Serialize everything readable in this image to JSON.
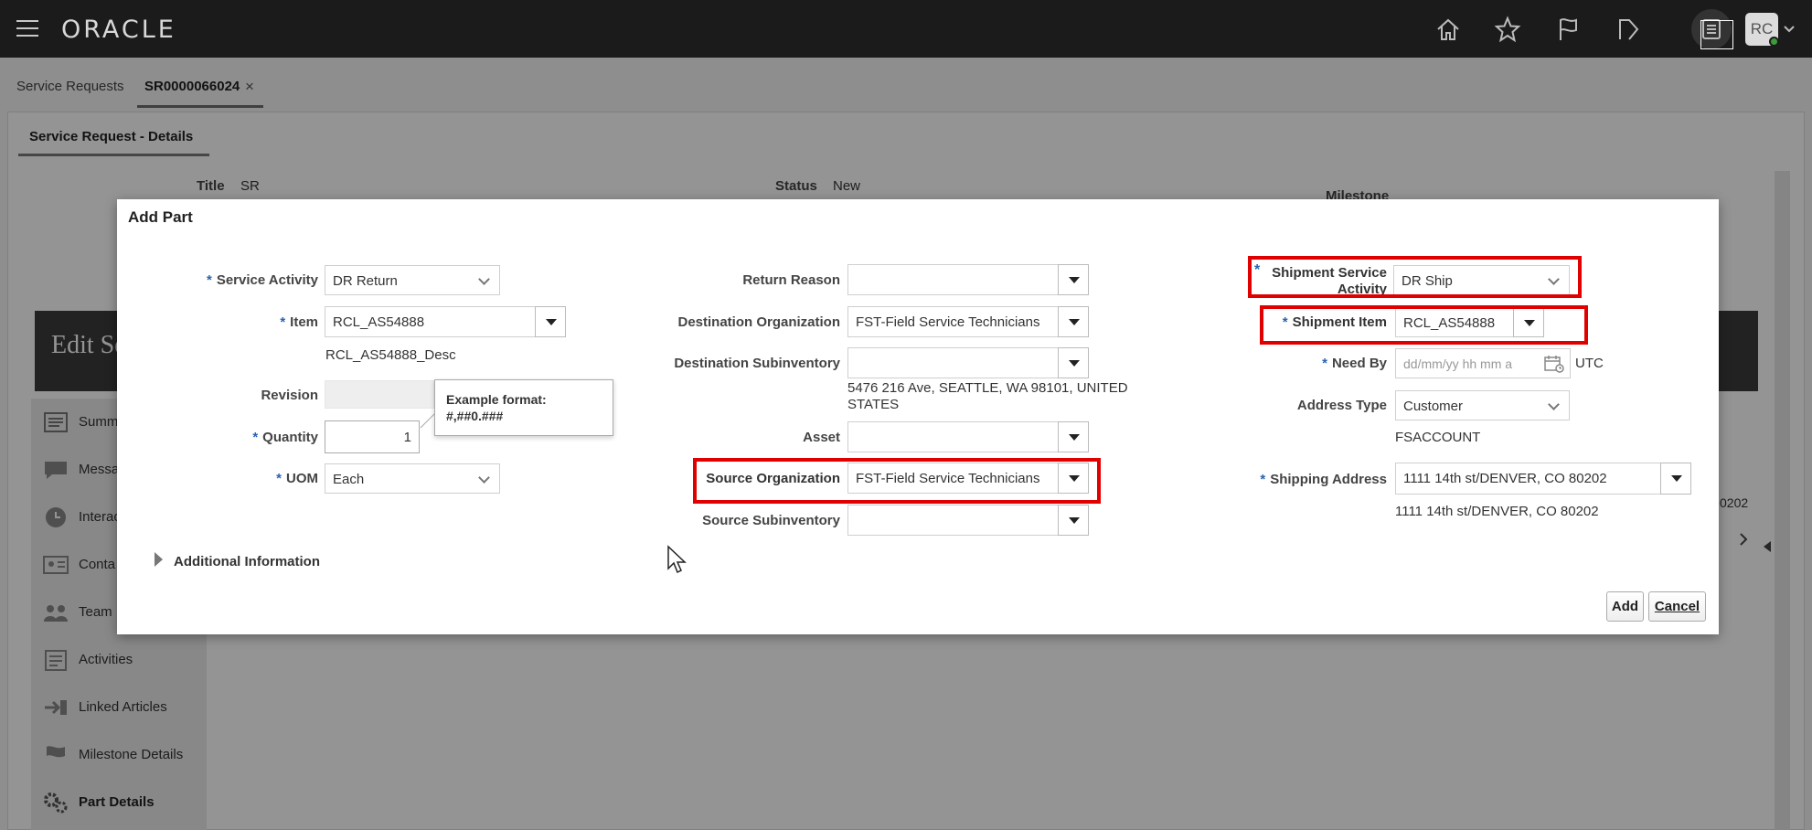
{
  "topbar": {
    "logo": "ORACLE",
    "avatar_initials": "RC"
  },
  "tabs": [
    {
      "label": "Service Requests"
    },
    {
      "label": "SR0000066024"
    }
  ],
  "subtab": "Service Request - Details",
  "background": {
    "title_label": "Title",
    "title_value": "SR",
    "status_label": "Status",
    "status_value": "New",
    "milestone_label": "Milestone",
    "edit_banner": "Edit Se",
    "partial_right_text": "0202",
    "sidebar": [
      {
        "label": "Summ",
        "icon": "summary-icon"
      },
      {
        "label": "Messa",
        "icon": "message-icon"
      },
      {
        "label": "Interac",
        "icon": "interaction-icon"
      },
      {
        "label": "Conta",
        "icon": "contact-icon"
      },
      {
        "label": "Team",
        "icon": "team-icon"
      },
      {
        "label": "Activities",
        "icon": "activities-icon"
      },
      {
        "label": "Linked Articles",
        "icon": "linked-articles-icon"
      },
      {
        "label": "Milestone Details",
        "icon": "milestone-icon"
      },
      {
        "label": "Part Details",
        "icon": "part-details-icon"
      }
    ]
  },
  "dialog": {
    "title": "Add Part",
    "col1": {
      "service_activity_label": "Service Activity",
      "service_activity_value": "DR Return",
      "item_label": "Item",
      "item_value": "RCL_AS54888",
      "item_desc": "RCL_AS54888_Desc",
      "revision_label": "Revision",
      "quantity_label": "Quantity",
      "quantity_value": "1",
      "uom_label": "UOM",
      "uom_value": "Each"
    },
    "tooltip": {
      "line1": "Example format:",
      "line2": "#,##0.###"
    },
    "col2": {
      "return_reason_label": "Return Reason",
      "return_reason_value": "",
      "dest_org_label": "Destination Organization",
      "dest_org_value": "FST-Field Service Technicians",
      "dest_subinv_label": "Destination Subinventory",
      "dest_subinv_value": "",
      "dest_address_line1": "5476 216 Ave, SEATTLE, WA 98101, UNITED",
      "dest_address_line2": "STATES",
      "asset_label": "Asset",
      "asset_value": "",
      "source_org_label": "Source Organization",
      "source_org_value": "FST-Field Service Technicians",
      "source_subinv_label": "Source Subinventory",
      "source_subinv_value": ""
    },
    "col3": {
      "ship_svc_activity_label_1": "Shipment Service",
      "ship_svc_activity_label_2": "Activity",
      "ship_svc_activity_value": "DR Ship",
      "shipment_item_label": "Shipment Item",
      "shipment_item_value": "RCL_AS54888",
      "need_by_label": "Need By",
      "need_by_placeholder": "dd/mm/yy hh mm a",
      "timezone": "UTC",
      "address_type_label": "Address Type",
      "address_type_value": "Customer",
      "account_value": "FSACCOUNT",
      "shipping_address_label": "Shipping Address",
      "shipping_address_value": "1111 14th st/DENVER, CO 80202",
      "shipping_address_text": "1111 14th st/DENVER, CO 80202"
    },
    "additional_info": "Additional Information",
    "add_button": "Add",
    "cancel_button": "Cancel",
    "highlight_color": "#e00000",
    "required_color": "#2962b0"
  }
}
